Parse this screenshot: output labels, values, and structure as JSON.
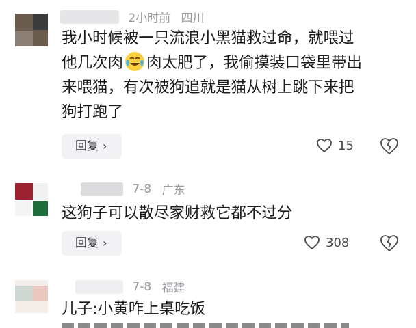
{
  "comments": [
    {
      "time": "2小时前",
      "location": "四川",
      "text_lines": [
        "我小时候被一只流浪小黑猫救过命，就喂过",
        "他几次肉",
        "肉太肥了，我偷摸装口袋里带出",
        "来喂猫，有次被狗追就是猫从树上跳下来把",
        "狗打跑了"
      ],
      "reply_label": "回复",
      "like_count": "15"
    },
    {
      "time": "7-8",
      "location": "广东",
      "text_lines": [
        "这狗子可以散尽家财救它都不过分"
      ],
      "reply_label": "回复",
      "like_count": "308"
    },
    {
      "time": "7-8",
      "location": "福建",
      "text_lines": [
        "儿子:小黄咋上桌吃饭"
      ]
    }
  ],
  "icons": {
    "like": "heart-outline-icon",
    "dislike": "broken-heart-icon",
    "chevron": "chevron-right-icon",
    "emoji": "crying-laughing-emoji"
  },
  "colors": {
    "meta": "#9a9aa0",
    "reply_bg": "#f2f2f4",
    "text": "#1c1c1e"
  }
}
